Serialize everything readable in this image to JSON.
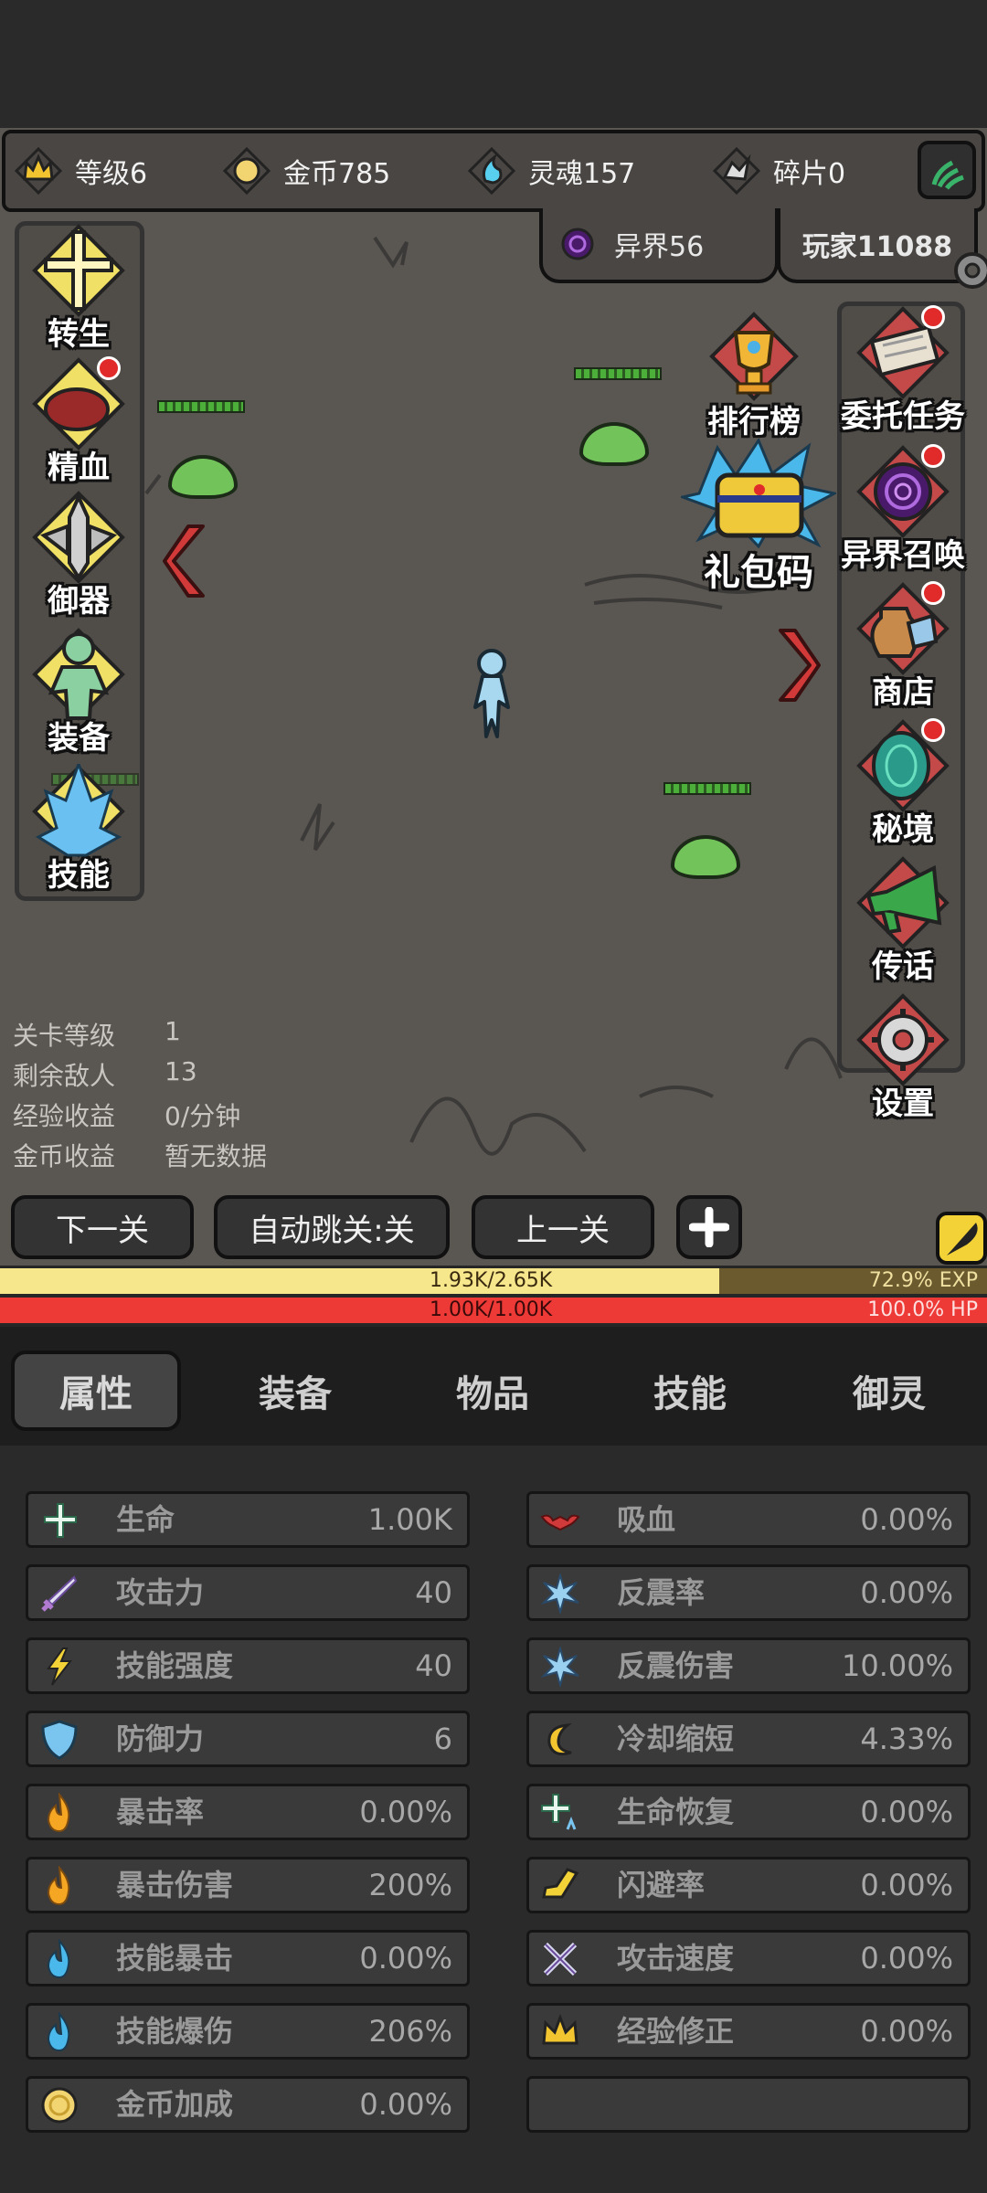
{
  "resources": {
    "level": "等级6",
    "gold": "金币785",
    "soul": "灵魂157",
    "shard": "碎片0"
  },
  "subtabs": {
    "otherworld": "异界56",
    "player": "玩家11088"
  },
  "left_menu": [
    {
      "label": "转生",
      "icon": "rebirth-cross-icon",
      "dot": false
    },
    {
      "label": "精血",
      "icon": "blood-meat-icon",
      "dot": true
    },
    {
      "label": "御器",
      "icon": "sword-artifact-icon",
      "dot": false
    },
    {
      "label": "装备",
      "icon": "equipment-figure-icon",
      "dot": false
    },
    {
      "label": "技能",
      "icon": "ice-skill-icon",
      "dot": false
    }
  ],
  "right_menu": [
    {
      "label": "委托任务",
      "icon": "scroll-quest-icon",
      "dot": true
    },
    {
      "label": "异界召唤",
      "icon": "portal-summon-icon",
      "dot": true
    },
    {
      "label": "商店",
      "icon": "shop-pot-icon",
      "dot": true
    },
    {
      "label": "秘境",
      "icon": "secret-realm-icon",
      "dot": true
    },
    {
      "label": "传话",
      "icon": "megaphone-icon",
      "dot": false
    },
    {
      "label": "设置",
      "icon": "gear-icon",
      "dot": false
    }
  ],
  "floating": {
    "leaderboard": "排行榜",
    "gift_code": "礼包码"
  },
  "stage_info": [
    {
      "label": "关卡等级",
      "value": "1"
    },
    {
      "label": "剩余敌人",
      "value": "13"
    },
    {
      "label": "经验收益",
      "value": "0/分钟"
    },
    {
      "label": "金币收益",
      "value": "暂无数据"
    }
  ],
  "actions": {
    "next": "下一关",
    "auto": "自动跳关:关",
    "prev": "上一关"
  },
  "exp": {
    "text": "1.93K/2.65K",
    "percent": "72.9% EXP",
    "fraction": 0.729
  },
  "hp": {
    "text": "1.00K/1.00K",
    "percent": "100.0%  HP",
    "fraction": 1.0
  },
  "tabs": [
    "属性",
    "装备",
    "物品",
    "技能",
    "御灵"
  ],
  "attributes_left": [
    {
      "name": "生命",
      "value": "1.00K",
      "icon": "health-cross-icon"
    },
    {
      "name": "攻击力",
      "value": "40",
      "icon": "sword-icon"
    },
    {
      "name": "技能强度",
      "value": "40",
      "icon": "lightning-icon"
    },
    {
      "name": "防御力",
      "value": "6",
      "icon": "shield-icon"
    },
    {
      "name": "暴击率",
      "value": "0.00%",
      "icon": "fire-icon"
    },
    {
      "name": "暴击伤害",
      "value": "200%",
      "icon": "fire-icon"
    },
    {
      "name": "技能暴击",
      "value": "0.00%",
      "icon": "blue-flame-icon"
    },
    {
      "name": "技能爆伤",
      "value": "206%",
      "icon": "blue-flame-icon"
    },
    {
      "name": "金币加成",
      "value": "0.00%",
      "icon": "coin-icon"
    }
  ],
  "attributes_right": [
    {
      "name": "吸血",
      "value": "0.00%",
      "icon": "bat-icon"
    },
    {
      "name": "反震率",
      "value": "0.00%",
      "icon": "spark-icon"
    },
    {
      "name": "反震伤害",
      "value": "10.00%",
      "icon": "spark-icon"
    },
    {
      "name": "冷却缩短",
      "value": "4.33%",
      "icon": "cooldown-icon"
    },
    {
      "name": "生命恢复",
      "value": "0.00%",
      "icon": "regen-icon"
    },
    {
      "name": "闪避率",
      "value": "0.00%",
      "icon": "boot-icon"
    },
    {
      "name": "攻击速度",
      "value": "0.00%",
      "icon": "crossed-swords-icon"
    },
    {
      "name": "经验修正",
      "value": "0.00%",
      "icon": "crown-icon"
    }
  ],
  "colors": {
    "exp_fill": "#f7e78c",
    "hp_fill": "#ee3a36",
    "slime": "#72c45a",
    "player": "#a8d8f0"
  }
}
